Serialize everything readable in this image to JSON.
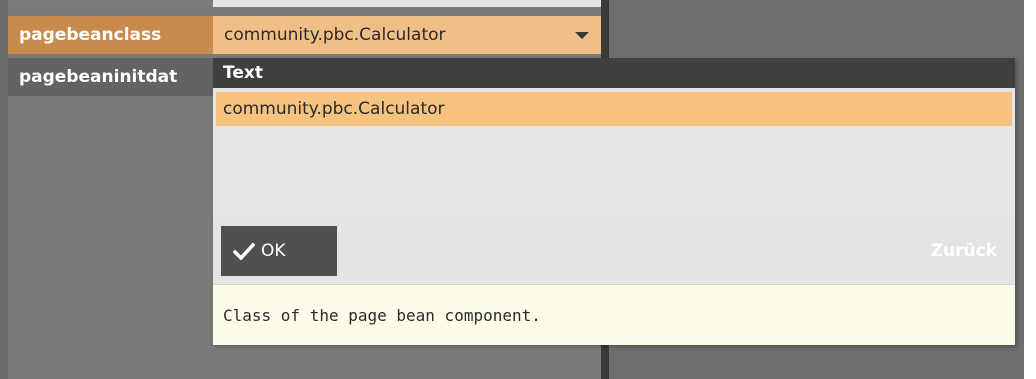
{
  "properties": [
    {
      "name": "pagebeanclass",
      "selected": true
    },
    {
      "name": "pagebeaninitdat",
      "selected": false
    }
  ],
  "value_editor": {
    "current_value": "community.pbc.Calculator"
  },
  "popup": {
    "header": "Text",
    "options": [
      {
        "label": "community.pbc.Calculator",
        "selected": true
      }
    ],
    "ok_label": "OK",
    "back_label": "Zurück",
    "description": "Class of the page bean component."
  },
  "icons": {
    "ok": "checkmark-icon",
    "dropdown": "chevron-down-icon"
  },
  "colors": {
    "accent_selected": "#c98a4e",
    "value_bg": "#f1bf86",
    "row_selected": "#f6c27f",
    "header_bg": "#3f3f3f",
    "description_bg": "#fcfce9"
  }
}
